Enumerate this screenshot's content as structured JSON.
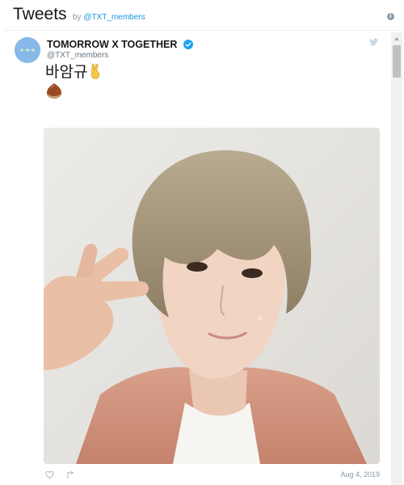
{
  "header": {
    "title": "Tweets",
    "by_prefix": "by",
    "by_handle": "@TXT_members",
    "info_icon": "info-icon"
  },
  "tweet": {
    "display_name": "TOMORROW X TOGETHER",
    "handle": "@TXT_members",
    "verified": true,
    "text": "바암규",
    "emoji": [
      "victory-hand",
      "chestnut"
    ],
    "date": "Aug 4, 2019",
    "icons": [
      "heart-icon",
      "share-icon",
      "twitter-bird-icon"
    ]
  },
  "colors": {
    "link": "#1b95e0",
    "verified": "#1da1f2",
    "avatar_bg": "#7fb5e6",
    "muted_text": "#8899a6"
  }
}
